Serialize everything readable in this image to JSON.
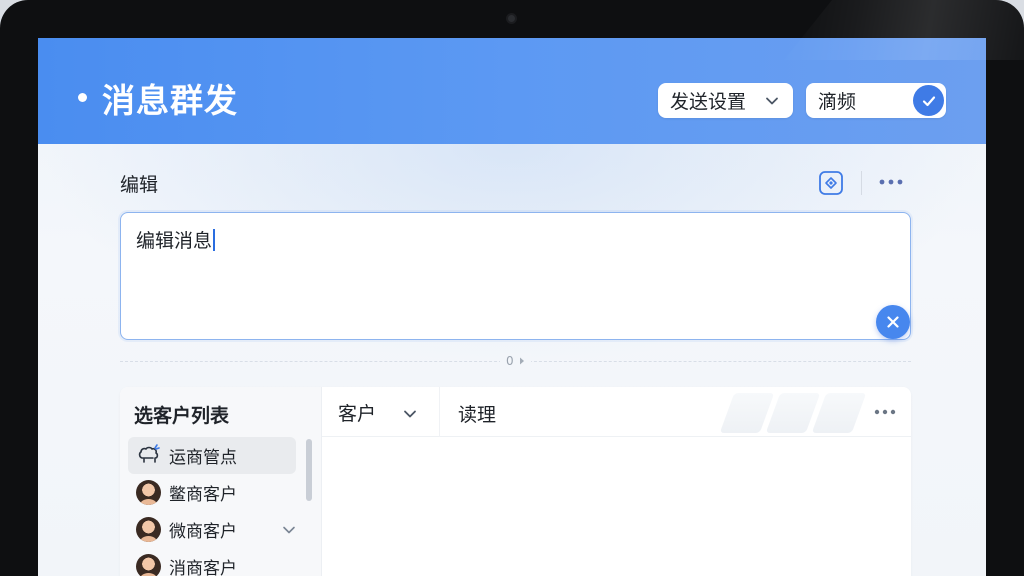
{
  "header": {
    "title": "消息群发",
    "send_settings": {
      "label": "发送设置"
    },
    "frequency_toggle": {
      "label": "滴频",
      "checked": true
    }
  },
  "editor": {
    "section_label": "编辑",
    "content": "编辑消息",
    "char_count": "0"
  },
  "customer_panel": {
    "list_title": "选客户列表",
    "items": [
      {
        "label": "运商管点",
        "icon": "sheep-icon",
        "active": true
      },
      {
        "label": "鳖商客户",
        "icon": "avatar"
      },
      {
        "label": "微商客户",
        "icon": "avatar",
        "expandable": true
      },
      {
        "label": "消商客户",
        "icon": "avatar"
      }
    ],
    "filter_label": "客户",
    "tab_label": "读理"
  },
  "colors": {
    "header_start": "#4a8df0",
    "header_end": "#6c9ff0",
    "accent": "#4787ee",
    "text": "#1f2329"
  }
}
